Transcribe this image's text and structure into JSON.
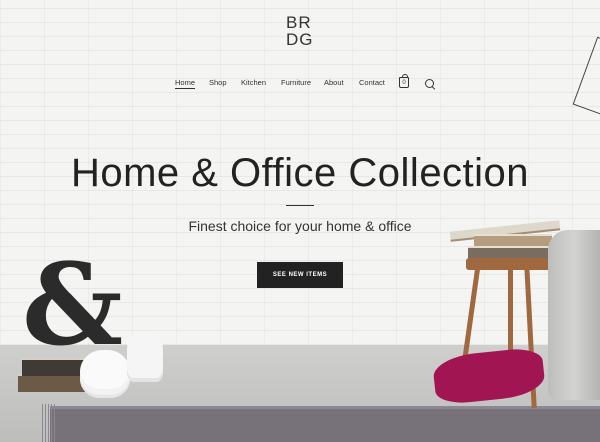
{
  "brand": {
    "logo_line1": "BR",
    "logo_line2": "DG"
  },
  "nav": {
    "items": [
      {
        "label": "Home",
        "active": true
      },
      {
        "label": "Shop"
      },
      {
        "label": "Kitchen"
      },
      {
        "label": "Furniture"
      },
      {
        "label": "About"
      },
      {
        "label": "Contact"
      }
    ],
    "cart_count": "0"
  },
  "hero": {
    "headline": "Home & Office Collection",
    "subline": "Finest choice for your home & office",
    "cta_label": "SEE NEW ITEMS"
  },
  "decor": {
    "ampersand": "&"
  },
  "colors": {
    "accent": "#222222",
    "pillow": "#a01552",
    "wood": "#a0683f"
  }
}
